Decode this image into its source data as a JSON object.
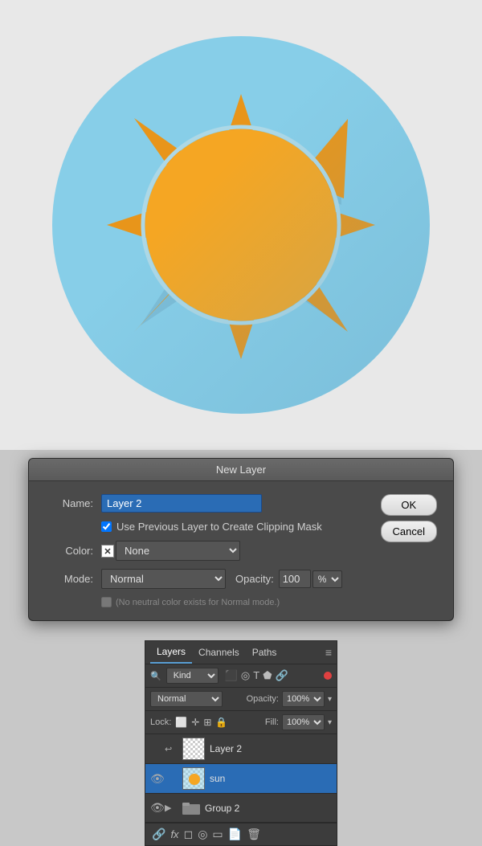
{
  "sun_area": {
    "bg_color": "#e8e8e8"
  },
  "dialog": {
    "title": "New Layer",
    "name_label": "Name:",
    "name_value": "Layer 2",
    "checkbox_label": "Use Previous Layer to Create Clipping Mask",
    "color_label": "Color:",
    "color_value": "None",
    "mode_label": "Mode:",
    "mode_value": "Normal",
    "opacity_label": "Opacity:",
    "opacity_value": "100",
    "opacity_unit": "%",
    "neutral_note": "(No neutral color exists for Normal mode.)",
    "ok_label": "OK",
    "cancel_label": "Cancel"
  },
  "layers_panel": {
    "tabs": [
      {
        "label": "Layers",
        "active": true
      },
      {
        "label": "Channels"
      },
      {
        "label": "Paths"
      }
    ],
    "filter_kind": "Kind",
    "blend_mode": "Normal",
    "opacity_label": "Opacity:",
    "opacity_value": "100%",
    "lock_label": "Lock:",
    "fill_label": "Fill:",
    "fill_value": "100%",
    "layers": [
      {
        "name": "Layer 2",
        "visible": false,
        "selected": false,
        "type": "layer"
      },
      {
        "name": "sun",
        "visible": true,
        "selected": true,
        "type": "layer"
      },
      {
        "name": "Group 2",
        "visible": true,
        "selected": false,
        "type": "group"
      }
    ],
    "toolbar_icons": [
      "link",
      "fx",
      "mask",
      "circle",
      "folder",
      "trash",
      "delete"
    ]
  }
}
